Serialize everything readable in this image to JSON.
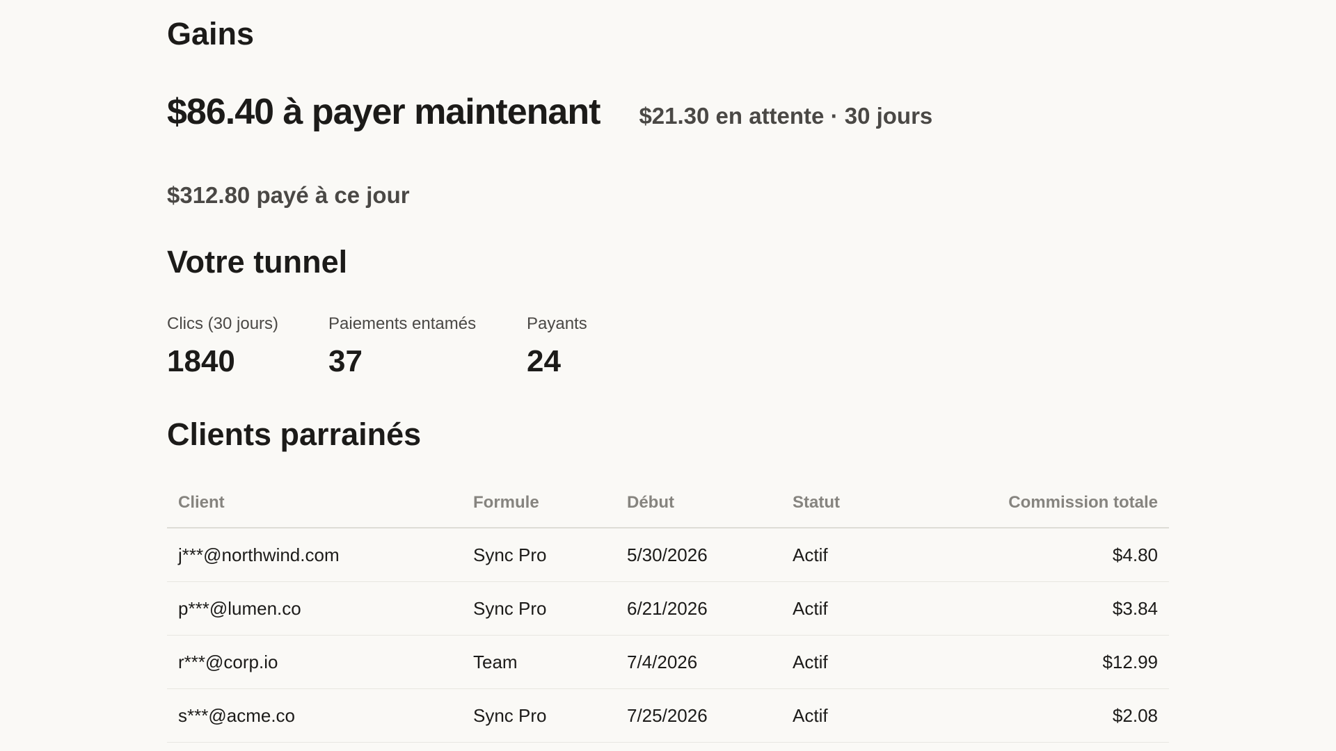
{
  "earnings": {
    "title": "Gains",
    "payable_now": "$86.40 à payer maintenant",
    "pending": "$21.30 en attente · 30 jours",
    "paid_to_date": "$312.80 payé à ce jour"
  },
  "funnel": {
    "title": "Votre tunnel",
    "stats": [
      {
        "label": "Clics (30 jours)",
        "value": "1840"
      },
      {
        "label": "Paiements entamés",
        "value": "37"
      },
      {
        "label": "Payants",
        "value": "24"
      }
    ]
  },
  "referred_clients": {
    "title": "Clients parrainés",
    "columns": [
      "Client",
      "Formule",
      "Début",
      "Statut",
      "Commission totale"
    ],
    "rows": [
      {
        "client": "j***@northwind.com",
        "plan": "Sync Pro",
        "start": "5/30/2026",
        "status": "Actif",
        "commission": "$4.80"
      },
      {
        "client": "p***@lumen.co",
        "plan": "Sync Pro",
        "start": "6/21/2026",
        "status": "Actif",
        "commission": "$3.84"
      },
      {
        "client": "r***@corp.io",
        "plan": "Team",
        "start": "7/4/2026",
        "status": "Actif",
        "commission": "$12.99"
      },
      {
        "client": "s***@acme.co",
        "plan": "Sync Pro",
        "start": "7/25/2026",
        "status": "Actif",
        "commission": "$2.08"
      }
    ]
  }
}
